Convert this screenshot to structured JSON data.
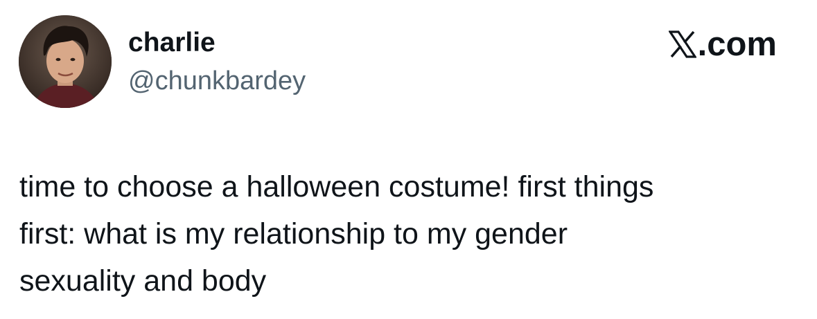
{
  "author": {
    "display_name": "charlie",
    "handle": "@chunkbardey",
    "avatar_icon": "profile-photo"
  },
  "brand": {
    "logo_icon": "x-logo-icon",
    "domain_suffix": ".com"
  },
  "tweet": {
    "lines": [
      "time to choose a halloween costume! first things",
      "first: what is my relationship to my gender",
      "sexuality and body"
    ]
  },
  "colors": {
    "text_primary": "#0f1419",
    "text_secondary": "#536471",
    "background": "#ffffff"
  }
}
